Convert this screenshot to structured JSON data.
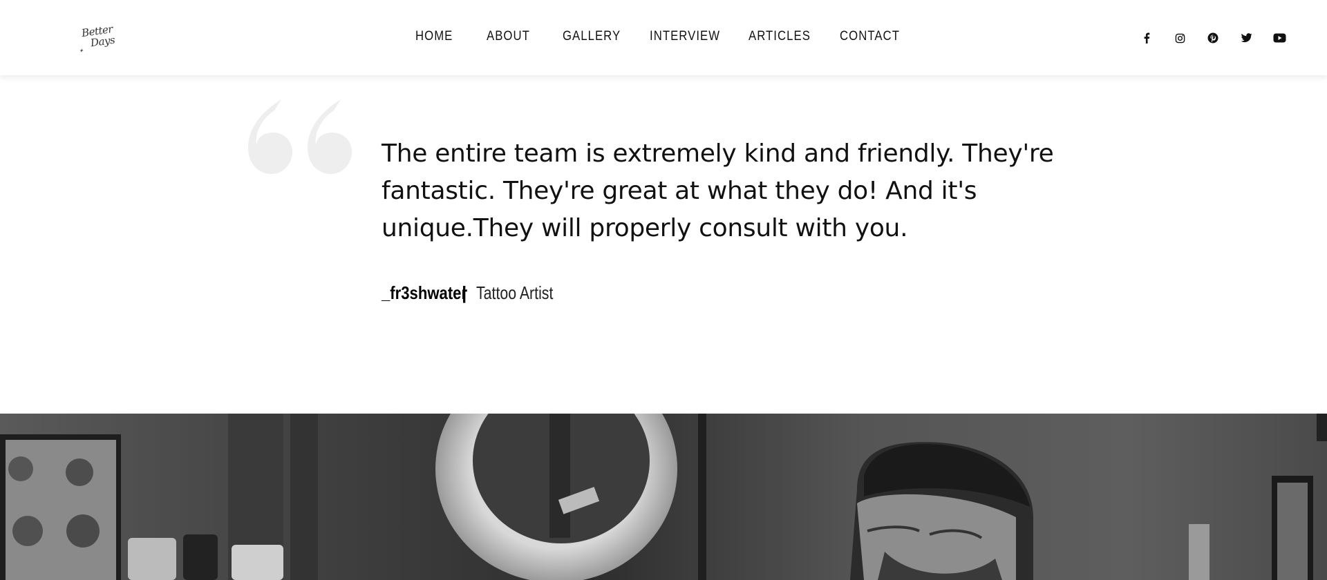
{
  "header": {
    "logo": {
      "line1": "Better",
      "line2": "Days"
    },
    "nav": [
      {
        "label": "HOME"
      },
      {
        "label": "ABOUT"
      },
      {
        "label": "GALLERY"
      },
      {
        "label": "INTERVIEW"
      },
      {
        "label": "ARTICLES"
      },
      {
        "label": "CONTACT"
      }
    ],
    "social": [
      "facebook-icon",
      "instagram-icon",
      "pinterest-icon",
      "twitter-icon",
      "youtube-icon"
    ]
  },
  "testimonial": {
    "quote": "The entire team is extremely kind and friendly. They're fantastic. They're great at what they do! And it's unique.They will properly consult with you.",
    "author": "_fr3shwater",
    "separator": "|",
    "role": "Tattoo Artist"
  },
  "colors": {
    "quote_mark": "#eeeeee",
    "text": "#111111",
    "header_bg": "#ffffff"
  }
}
